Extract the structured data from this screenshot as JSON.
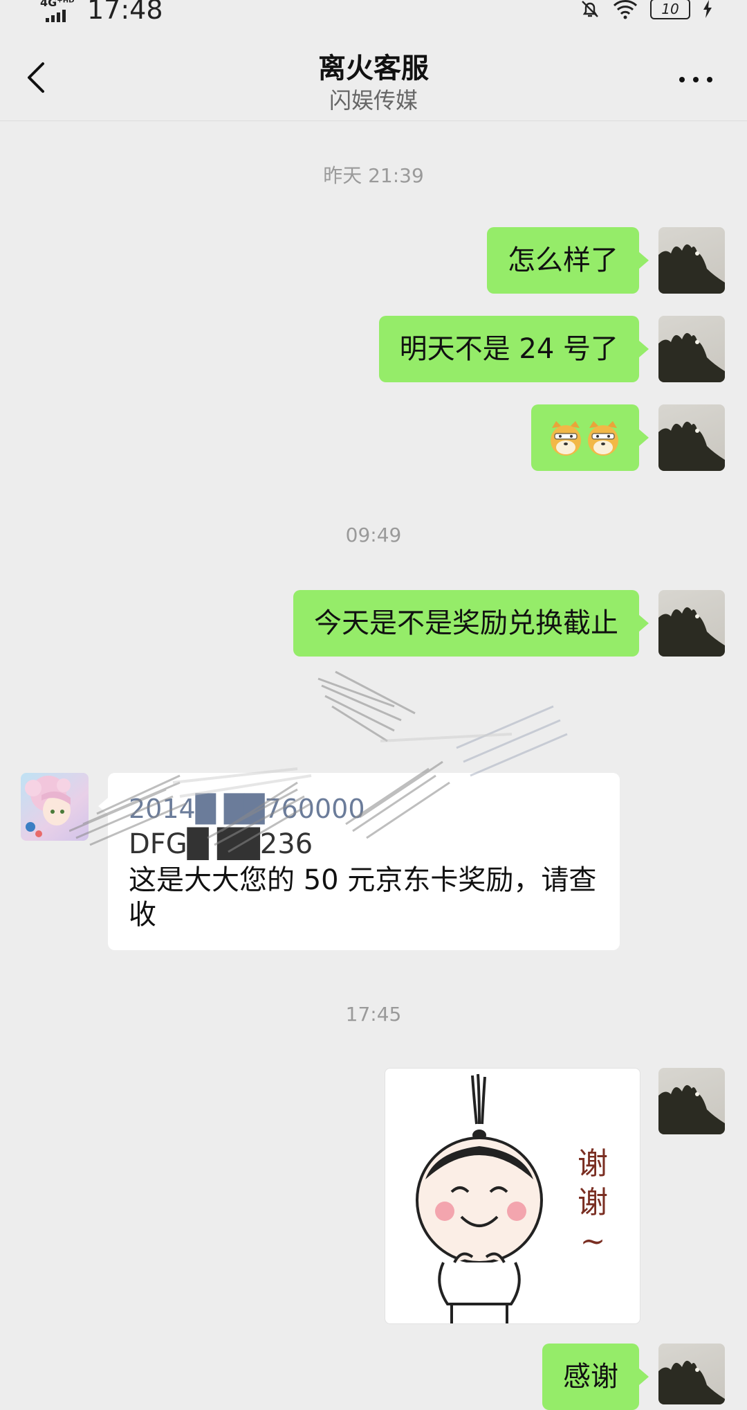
{
  "status_bar": {
    "network": "4G⁺ᴴᴰ",
    "time": "17:48",
    "battery": "10"
  },
  "header": {
    "title": "离火客服",
    "subtitle": "闪娱传媒"
  },
  "timestamps": [
    "昨天 21:39",
    "09:49",
    "17:45"
  ],
  "messages": {
    "m1": "怎么样了",
    "m2": "明天不是 24 号了",
    "m3": "🐱🐱",
    "m4": "今天是不是奖励兑换截止",
    "reward_line1": "2014█ ██760000",
    "reward_line2": "DFG█ ██236",
    "reward_text": "这是大大您的 50 元京东卡奖励，请查收",
    "thanks": "感谢"
  },
  "sticker": {
    "caption": "谢谢~"
  }
}
